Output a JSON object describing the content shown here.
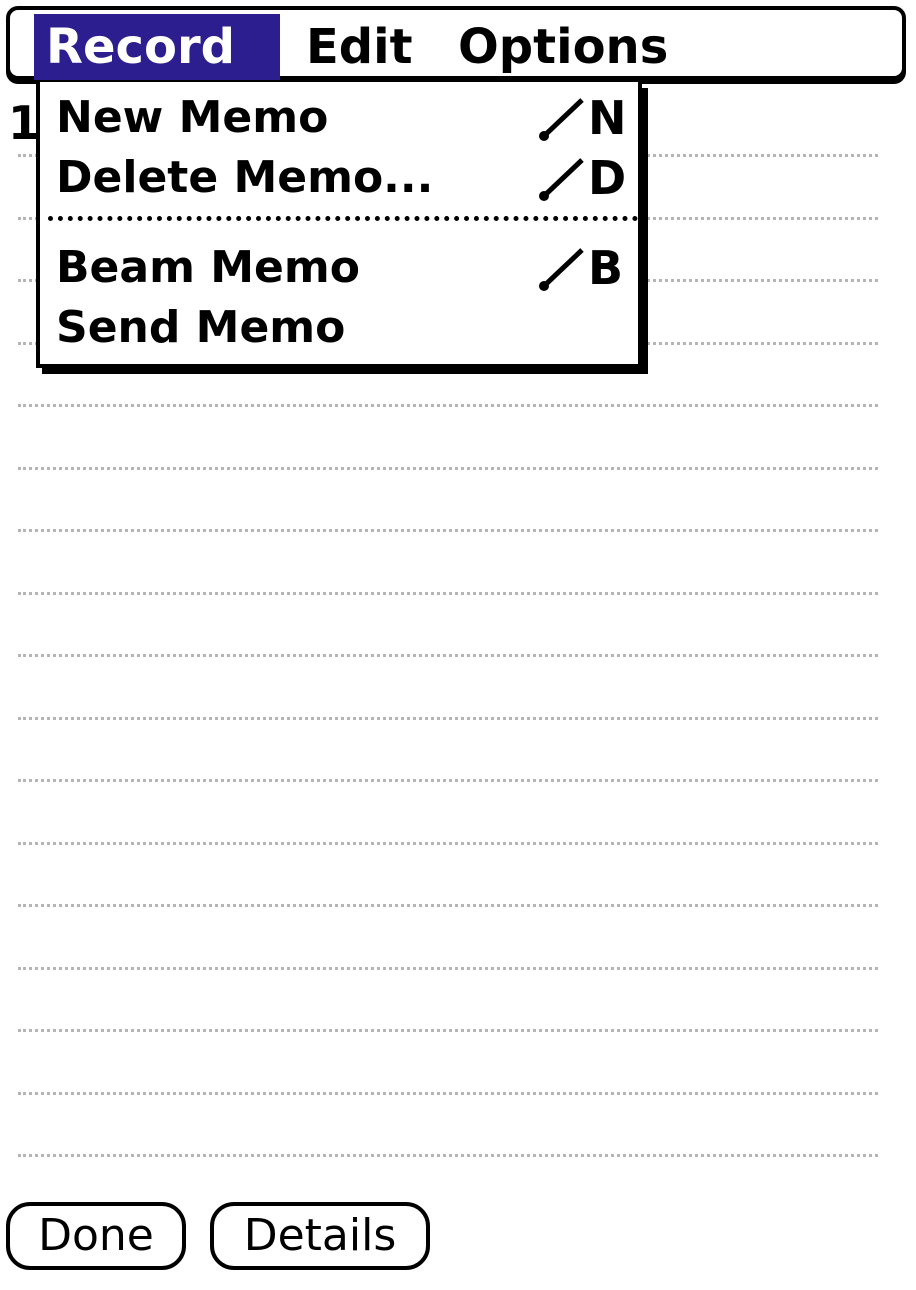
{
  "menubar": {
    "items": [
      {
        "label": "Record",
        "active": true
      },
      {
        "label": "Edit",
        "active": false
      },
      {
        "label": "Options",
        "active": false
      }
    ]
  },
  "record_menu": {
    "items": [
      {
        "label": "New Memo",
        "shortcut": "N"
      },
      {
        "label": "Delete Memo...",
        "shortcut": "D"
      },
      {
        "label": "Beam Memo",
        "shortcut": "B"
      },
      {
        "label": "Send Memo",
        "shortcut": ""
      }
    ]
  },
  "memo": {
    "first_char": "1"
  },
  "buttons": {
    "done_label": "Done",
    "details_label": "Details"
  },
  "colors": {
    "menu_highlight": "#2c1e8e",
    "line_color": "#b5b5b5"
  }
}
